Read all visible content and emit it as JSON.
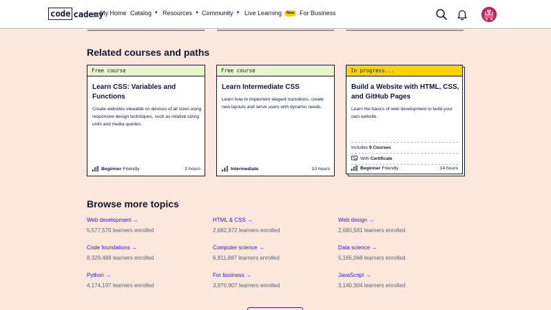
{
  "header": {
    "logo": {
      "boxed": "code",
      "rest": "cademy"
    },
    "nav": [
      {
        "label": "My Home",
        "has_caret": false
      },
      {
        "label": "Catalog",
        "has_caret": true
      },
      {
        "label": "Resources",
        "has_caret": true
      },
      {
        "label": "Community",
        "has_caret": true
      },
      {
        "label": "Live Learning",
        "has_caret": false,
        "badge": "New"
      },
      {
        "label": "For Business",
        "has_caret": false
      }
    ],
    "icons": [
      "search-icon",
      "bell-icon",
      "avatar"
    ]
  },
  "related": {
    "title": "Related courses and paths",
    "cards": [
      {
        "tag": "Free course",
        "title": "Learn CSS: Variables and Functions",
        "description": "Create websites viewable on devices of all sizes using responsive design techniques, such as relative sizing units and media queries.",
        "level_bold": "Beginner",
        "level_rest": "Friendly",
        "duration": "2 hours"
      },
      {
        "tag": "Free course",
        "title": "Learn Intermediate CSS",
        "description": "Learn how to implement elegant transitions, create new layouts and serve users with dynamic needs.",
        "level_bold": "Intermediate",
        "level_rest": "",
        "duration": "10 hours"
      },
      {
        "tag": "In progress...",
        "title": "Build a Website with HTML, CSS, and GitHub Pages",
        "description": "Learn the basics of web development to build your own website.",
        "includes_prefix": "Includes",
        "includes_bold": "9 Courses",
        "certificate_prefix": "With",
        "certificate_bold": "Certificate",
        "level_bold": "Beginner",
        "level_rest": "Friendly",
        "duration": "14 hours"
      }
    ]
  },
  "topics": {
    "title": "Browse more topics",
    "items": [
      {
        "label": "Web development",
        "count": "5,577,570 learners enrolled"
      },
      {
        "label": "HTML & CSS",
        "count": "2,682,972 learners enrolled"
      },
      {
        "label": "Web design",
        "count": "2,680,581 learners enrolled"
      },
      {
        "label": "Code foundations",
        "count": "8,329,489 learners enrolled"
      },
      {
        "label": "Computer science",
        "count": "6,811,887 learners enrolled"
      },
      {
        "label": "Data science",
        "count": "5,165,068 learners enrolled"
      },
      {
        "label": "Python",
        "count": "4,174,197 learners enrolled"
      },
      {
        "label": "For business",
        "count": "3,970,907 learners enrolled"
      },
      {
        "label": "JavaScript",
        "count": "3,140,304 learners enrolled"
      }
    ],
    "arrow": "→"
  },
  "colors": {
    "page_bg": "#fbe7dc",
    "link": "#3a10e5",
    "free_tag_bg": "#e6f7c9",
    "progress_tag_bg": "#ffd300",
    "navy": "#10162f"
  }
}
